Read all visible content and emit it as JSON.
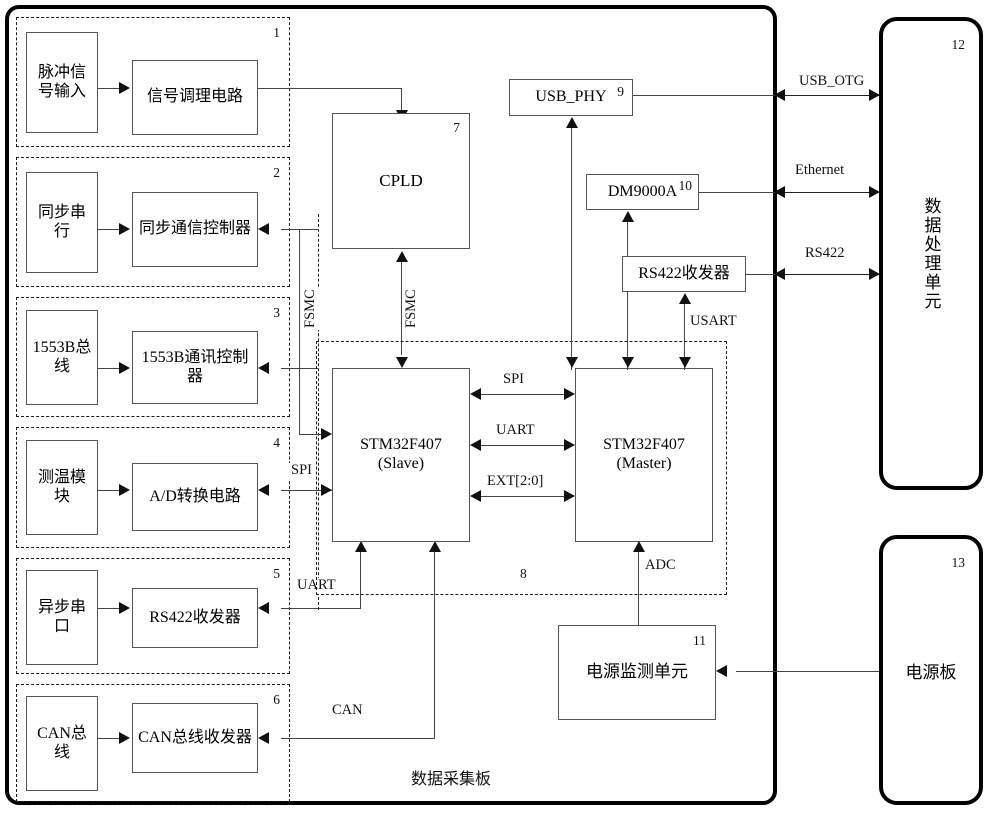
{
  "diagram": {
    "title": "数据采集板",
    "board_caption": "数据采集板"
  },
  "groups": [
    {
      "id": "1",
      "index": "1",
      "source_label": "脉冲信号输入",
      "circuit_label": "信号调理电路"
    },
    {
      "id": "2",
      "index": "2",
      "source_label": "同步串行",
      "circuit_label": "同步通信控制器"
    },
    {
      "id": "3",
      "index": "3",
      "source_label": "1553B总线",
      "circuit_label": "1553B通讯控制器"
    },
    {
      "id": "4",
      "index": "4",
      "source_label": "测温模块",
      "circuit_label": "A/D转换电路"
    },
    {
      "id": "5",
      "index": "5",
      "source_label": "异步串口",
      "circuit_label": "RS422收发器"
    },
    {
      "id": "6",
      "index": "6",
      "source_label": "CAN总线",
      "circuit_label": "CAN总线收发器"
    }
  ],
  "blocks": {
    "cpld": {
      "index": "7",
      "label": "CPLD"
    },
    "region8": {
      "index": "8"
    },
    "usb_phy": {
      "index": "9",
      "label": "USB_PHY"
    },
    "dm9000a": {
      "index": "10",
      "label": "DM9000A"
    },
    "power_mon": {
      "index": "11",
      "label": "电源监测单元"
    },
    "data_unit": {
      "index": "12",
      "label": "数据处理单元"
    },
    "power_board": {
      "index": "13",
      "label": "电源板"
    },
    "mcu_slave": {
      "label_line1": "STM32F407",
      "label_line2": "(Slave)"
    },
    "mcu_master": {
      "label_line1": "STM32F407",
      "label_line2": "(Master)"
    },
    "rs422_xcvr": {
      "label": "RS422收发器"
    }
  },
  "bus_labels": {
    "fsmc_left": "FSMC",
    "fsmc_cpld": "FSMC",
    "spi_left": "SPI",
    "uart_left": "UART",
    "can_left": "CAN",
    "spi_mid": "SPI",
    "uart_mid": "UART",
    "ext_mid": "EXT[2:0]",
    "usart": "USART",
    "adc": "ADC",
    "usb_otg": "USB_OTG",
    "ethernet": "Ethernet",
    "rs422": "RS422"
  },
  "colors": {
    "line": "#444444",
    "border": "#555555",
    "dashed": "#1a1a1a",
    "background": "#ffffff"
  }
}
